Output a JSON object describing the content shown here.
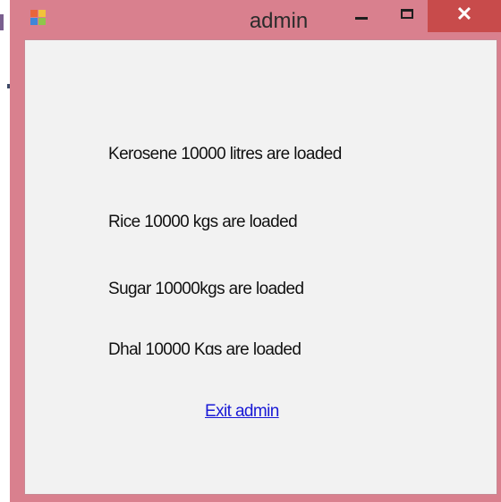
{
  "window": {
    "title": "admin",
    "icon": "app-window-icon",
    "controls": {
      "minimize": "minimize-icon",
      "maximize": "maximize-icon",
      "close_glyph": "✕"
    }
  },
  "messages": [
    "Kerosene 10000 litres are loaded",
    "Rice 10000 kgs are loaded",
    "Sugar 10000kgs are loaded",
    "Dhal 10000 Kgs are loaded"
  ],
  "exit_link": "Exit admin",
  "colors": {
    "frame": "#d9808e",
    "client": "#f2f2f2",
    "close_button": "#c84b4b",
    "link": "#1a1ad6"
  }
}
